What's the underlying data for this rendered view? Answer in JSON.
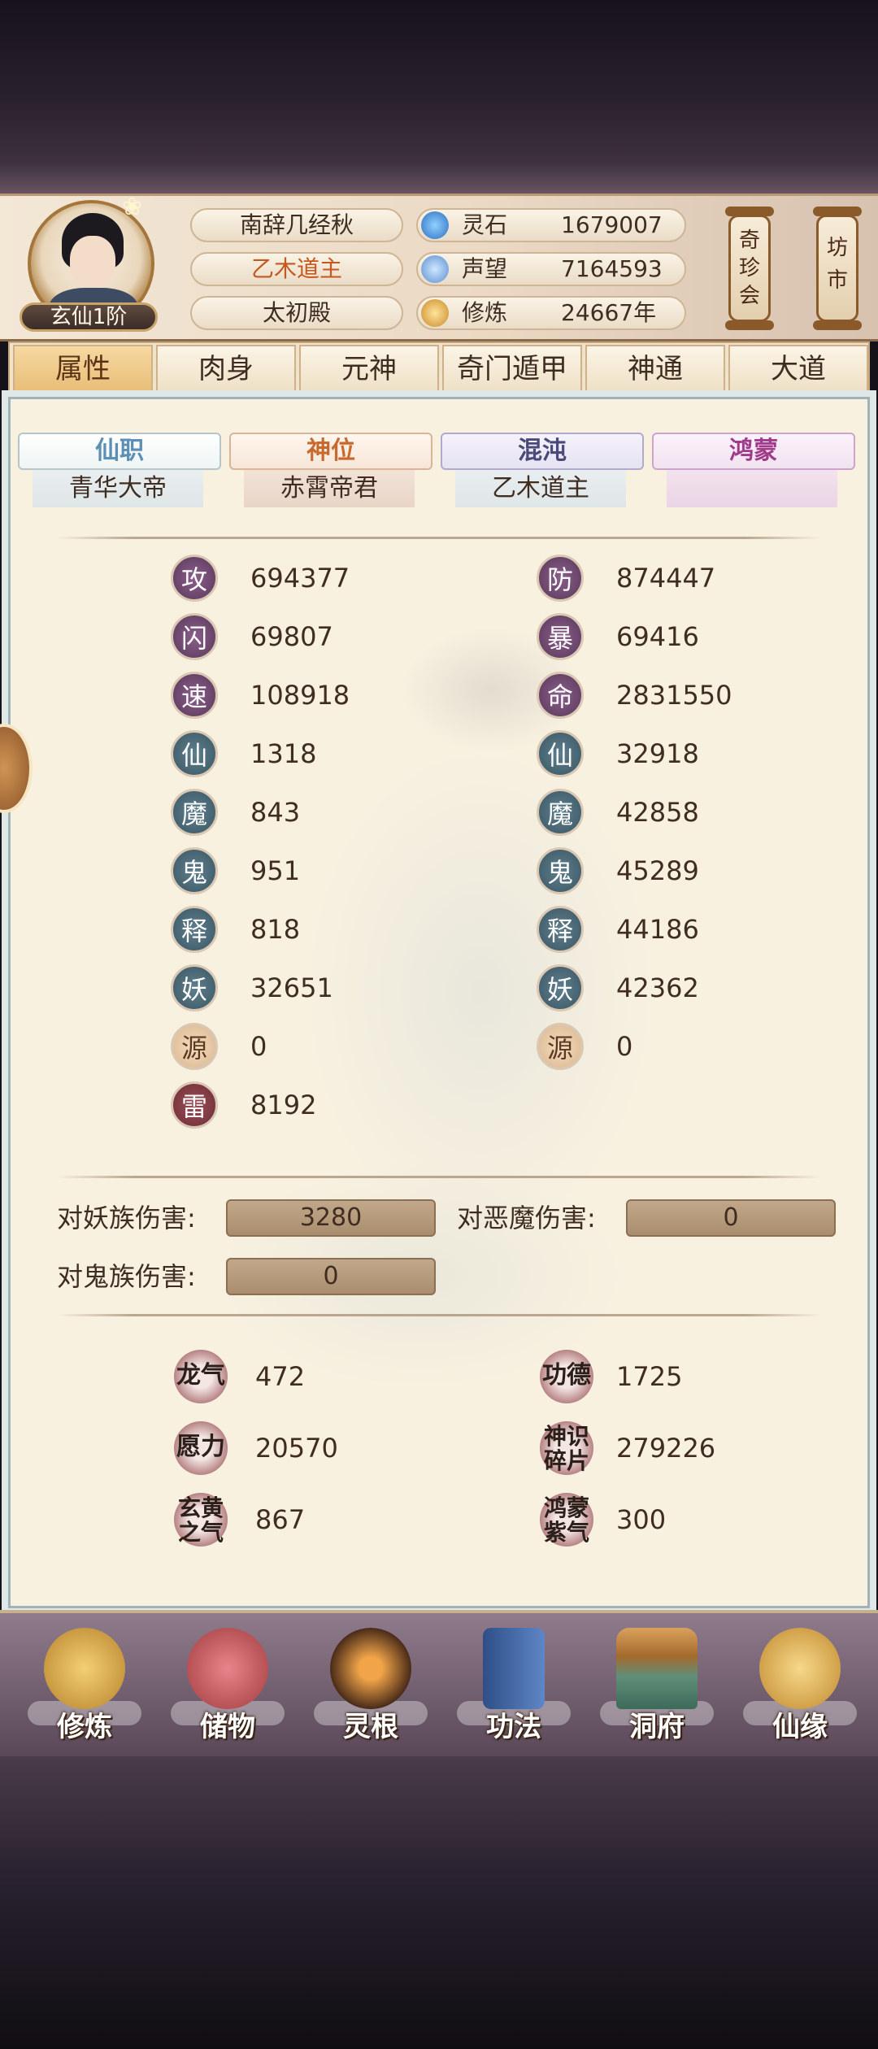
{
  "player": {
    "name": "南辞几经秋",
    "realm": "乙木道主",
    "palace": "太初殿",
    "rank_badge": "玄仙1阶"
  },
  "resources": [
    {
      "icon": "spirit-stone-icon",
      "label": "灵石",
      "value": "1679007"
    },
    {
      "icon": "reputation-icon",
      "label": "声望",
      "value": "7164593"
    },
    {
      "icon": "cultivation-icon",
      "label": "修炼",
      "value": "24667年"
    }
  ],
  "side_buttons": [
    {
      "label": "奇珍会"
    },
    {
      "label": "坊市"
    }
  ],
  "tabs": [
    {
      "label": "属性",
      "active": true
    },
    {
      "label": "肉身",
      "active": false
    },
    {
      "label": "元神",
      "active": false
    },
    {
      "label": "奇门遁甲",
      "active": false
    },
    {
      "label": "神通",
      "active": false
    },
    {
      "label": "大道",
      "active": false
    }
  ],
  "titles": [
    {
      "title": "仙职",
      "value": "青华大帝",
      "color": "#5b8fb5"
    },
    {
      "title": "神位",
      "value": "赤霄帝君",
      "color": "#c86a2d"
    },
    {
      "title": "混沌",
      "value": "乙木道主",
      "color": "#4a4a7a"
    },
    {
      "title": "鸿蒙",
      "value": "",
      "color": "#a03a8a"
    }
  ],
  "stats_left": [
    {
      "icon": "攻",
      "value": "694377"
    },
    {
      "icon": "闪",
      "value": "69807"
    },
    {
      "icon": "速",
      "value": "108918"
    },
    {
      "icon": "仙",
      "value": "1318"
    },
    {
      "icon": "魔",
      "value": "843"
    },
    {
      "icon": "鬼",
      "value": "951"
    },
    {
      "icon": "释",
      "value": "818"
    },
    {
      "icon": "妖",
      "value": "32651"
    },
    {
      "icon": "源",
      "value": "0"
    },
    {
      "icon": "雷",
      "value": "8192"
    }
  ],
  "stats_right": [
    {
      "icon": "防",
      "value": "874447"
    },
    {
      "icon": "暴",
      "value": "69416"
    },
    {
      "icon": "命",
      "value": "2831550"
    },
    {
      "icon": "仙",
      "value": "32918"
    },
    {
      "icon": "魔",
      "value": "42858"
    },
    {
      "icon": "鬼",
      "value": "45289"
    },
    {
      "icon": "释",
      "value": "44186"
    },
    {
      "icon": "妖",
      "value": "42362"
    },
    {
      "icon": "源",
      "value": "0"
    }
  ],
  "damage": [
    {
      "label": "对妖族伤害:",
      "value": "3280"
    },
    {
      "label": "对恶魔伤害:",
      "value": "0"
    },
    {
      "label": "对鬼族伤害:",
      "value": "0"
    }
  ],
  "extras": [
    {
      "icon": "龙气",
      "value": "472"
    },
    {
      "icon": "功德",
      "value": "1725"
    },
    {
      "icon": "愿力",
      "value": "20570"
    },
    {
      "icon": "神识\n碎片",
      "value": "279226"
    },
    {
      "icon": "玄黄\n之气",
      "value": "867"
    },
    {
      "icon": "鸿蒙\n紫气",
      "value": "300"
    }
  ],
  "bottom_nav": [
    {
      "label": "修炼",
      "icon": "meditating-monk-icon"
    },
    {
      "label": "储物",
      "icon": "treasure-bag-icon"
    },
    {
      "label": "灵根",
      "icon": "spirit-root-icon"
    },
    {
      "label": "功法",
      "icon": "scripture-book-icon"
    },
    {
      "label": "洞府",
      "icon": "cave-mansion-icon"
    },
    {
      "label": "仙缘",
      "icon": "gourd-fortune-icon"
    }
  ]
}
